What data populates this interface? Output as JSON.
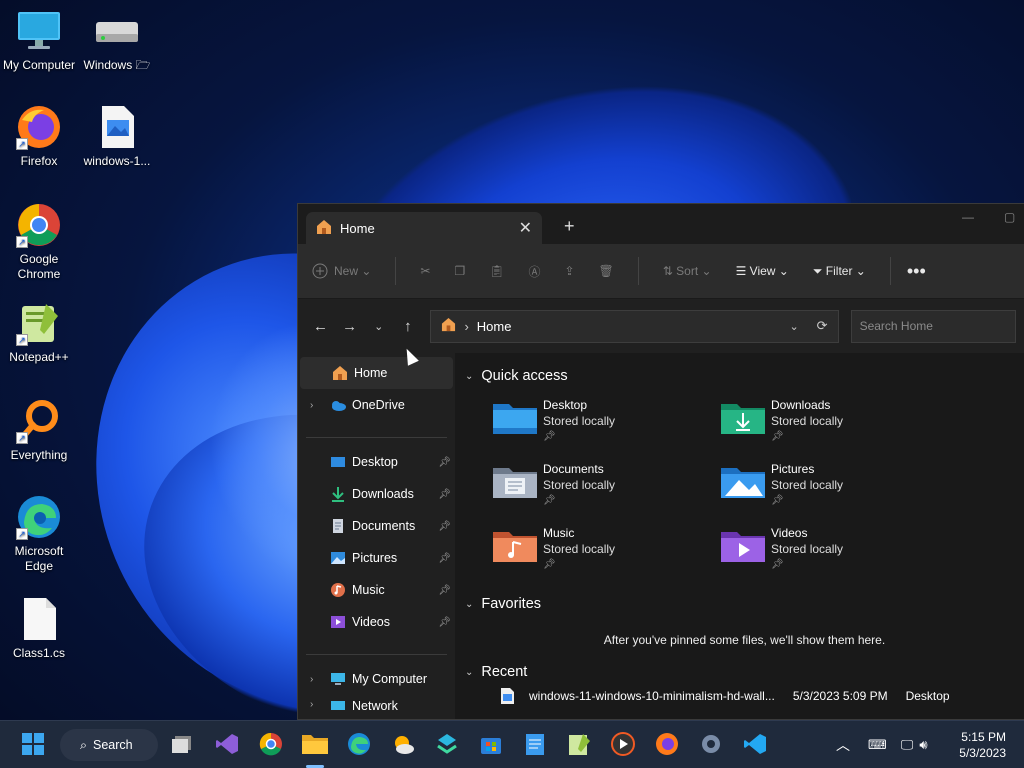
{
  "desktop": {
    "icons": [
      {
        "label": "My Computer",
        "icon": "computer-icon"
      },
      {
        "label": "Windows 🗁",
        "icon": "drive-icon"
      },
      {
        "label": "Firefox",
        "icon": "firefox-icon"
      },
      {
        "label": "windows-1...",
        "icon": "image-file-icon"
      },
      {
        "label": "Google Chrome",
        "icon": "chrome-icon"
      },
      {
        "label": "Notepad++",
        "icon": "notepadpp-icon"
      },
      {
        "label": "Everything",
        "icon": "everything-icon"
      },
      {
        "label": "Microsoft Edge",
        "icon": "edge-icon"
      },
      {
        "label": "Class1.cs",
        "icon": "file-icon"
      }
    ]
  },
  "explorer": {
    "tab_title": "Home",
    "toolbar": {
      "new_label": "New",
      "sort_label": "Sort",
      "view_label": "View",
      "filter_label": "Filter"
    },
    "address": {
      "location": "Home",
      "search_placeholder": "Search Home"
    },
    "nav": {
      "home": "Home",
      "onedrive": "OneDrive",
      "pinned": [
        "Desktop",
        "Downloads",
        "Documents",
        "Pictures",
        "Music",
        "Videos"
      ],
      "my_computer": "My Computer",
      "network": "Network"
    },
    "quick_access": {
      "title": "Quick access",
      "items": [
        {
          "name": "Desktop",
          "status": "Stored locally",
          "color": "#2e8be0"
        },
        {
          "name": "Downloads",
          "status": "Stored locally",
          "color": "#1fa37a"
        },
        {
          "name": "Documents",
          "status": "Stored locally",
          "color": "#8a98ad"
        },
        {
          "name": "Pictures",
          "status": "Stored locally",
          "color": "#2f8bdc"
        },
        {
          "name": "Music",
          "status": "Stored locally",
          "color": "#e0704a"
        },
        {
          "name": "Videos",
          "status": "Stored locally",
          "color": "#8c4fd8"
        }
      ]
    },
    "favorites": {
      "title": "Favorites",
      "empty_text": "After you've pinned some files, we'll show them here."
    },
    "recent": {
      "title": "Recent",
      "rows": [
        {
          "name": "windows-11-windows-10-minimalism-hd-wall...",
          "date": "5/3/2023 5:09 PM",
          "location": "Desktop"
        }
      ]
    }
  },
  "taskbar": {
    "search_label": "Search",
    "time": "5:15 PM",
    "date": "5/3/2023"
  }
}
